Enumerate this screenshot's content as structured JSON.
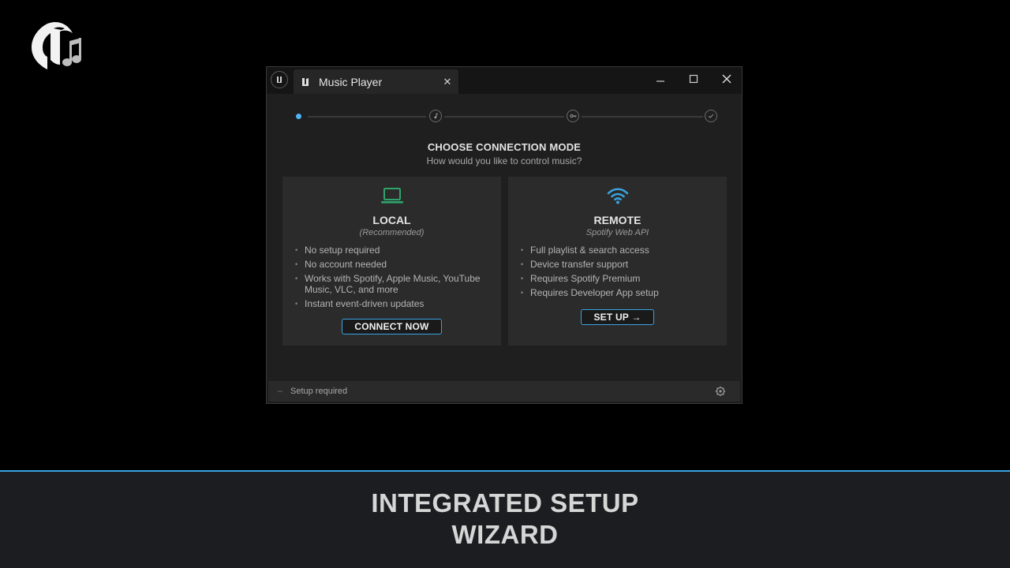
{
  "window": {
    "title": "Music Player",
    "close_glyph": "✕"
  },
  "stepper": {
    "steps": [
      "connection-mode",
      "music-note-icon",
      "key-icon",
      "check-icon"
    ],
    "active_index": 0
  },
  "heading": "CHOOSE CONNECTION MODE",
  "subheading": "How would you like to control music?",
  "cards": {
    "local": {
      "icon": "laptop-icon",
      "title": "LOCAL",
      "subtitle": "(Recommended)",
      "features": [
        "No setup required",
        "No account needed",
        "Works with Spotify, Apple Music, YouTube Music, VLC, and more",
        "Instant event-driven updates"
      ],
      "button_label": "CONNECT NOW"
    },
    "remote": {
      "icon": "wifi-icon",
      "title": "REMOTE",
      "subtitle": "Spotify Web API",
      "features": [
        "Full playlist & search access",
        "Device transfer support",
        "Requires Spotify Premium",
        "Requires Developer App setup"
      ],
      "button_label": "SET UP →"
    }
  },
  "status": {
    "dash": "–",
    "text": "Setup required"
  },
  "footer": {
    "line1": "INTEGRATED SETUP",
    "line2": "WIZARD"
  },
  "colors": {
    "accent": "#3aa3e0",
    "local_icon": "#2fa36b",
    "remote_icon": "#3aa3e0"
  }
}
